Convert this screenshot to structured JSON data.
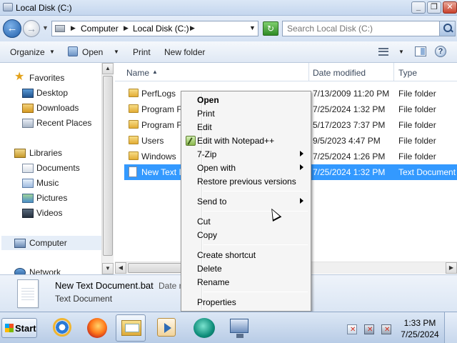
{
  "window": {
    "title": "Local Disk (C:)",
    "controls": {
      "minimize": "_",
      "maximize": "❐",
      "close": "✕"
    }
  },
  "address": {
    "segments": [
      "Computer",
      "Local Disk (C:)"
    ],
    "search_placeholder": "Search Local Disk (C:)"
  },
  "toolbar": {
    "organize": "Organize",
    "open": "Open",
    "print": "Print",
    "new_folder": "New folder"
  },
  "nav": {
    "favorites": "Favorites",
    "desktop": "Desktop",
    "downloads": "Downloads",
    "recent": "Recent Places",
    "libraries": "Libraries",
    "documents": "Documents",
    "music": "Music",
    "pictures": "Pictures",
    "videos": "Videos",
    "computer": "Computer",
    "network": "Network"
  },
  "columns": {
    "name": "Name",
    "date": "Date modified",
    "type": "Type"
  },
  "files": [
    {
      "name": "PerfLogs",
      "date": "7/13/2009 11:20 PM",
      "type": "File folder"
    },
    {
      "name": "Program F",
      "date": "7/25/2024 1:32 PM",
      "type": "File folder"
    },
    {
      "name": "Program F",
      "date": "5/17/2023 7:37 PM",
      "type": "File folder"
    },
    {
      "name": "Users",
      "date": "9/5/2023 4:47 PM",
      "type": "File folder"
    },
    {
      "name": "Windows",
      "date": "7/25/2024 1:26 PM",
      "type": "File folder"
    },
    {
      "name": "New Text I",
      "date": "7/25/2024 1:32 PM",
      "type": "Text Document"
    }
  ],
  "details": {
    "name": "New Text Document.bat",
    "date_label": "Date m",
    "type": "Text Document"
  },
  "context_menu": {
    "open": "Open",
    "print": "Print",
    "edit": "Edit",
    "edit_notepad": "Edit with Notepad++",
    "zip": "7-Zip",
    "open_with": "Open with",
    "restore": "Restore previous versions",
    "send_to": "Send to",
    "cut": "Cut",
    "copy": "Copy",
    "create_shortcut": "Create shortcut",
    "delete": "Delete",
    "rename": "Rename",
    "properties": "Properties"
  },
  "taskbar": {
    "start": "Start",
    "time": "1:33 PM",
    "date": "7/25/2024"
  }
}
